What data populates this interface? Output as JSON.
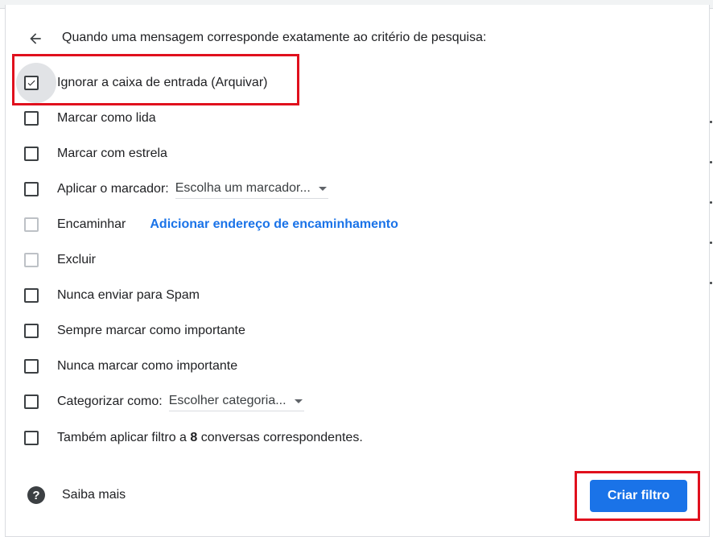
{
  "header": {
    "text": "Quando uma mensagem corresponde exatamente ao critério de pesquisa:"
  },
  "options": {
    "archive": "Ignorar a caixa de entrada (Arquivar)",
    "mark_read": "Marcar como lida",
    "star": "Marcar com estrela",
    "apply_label": "Aplicar o marcador:",
    "label_select": "Escolha um marcador...",
    "forward": "Encaminhar",
    "forward_link": "Adicionar endereço de encaminhamento",
    "delete": "Excluir",
    "never_spam": "Nunca enviar para Spam",
    "always_important": "Sempre marcar como importante",
    "never_important": "Nunca marcar como importante",
    "categorize": "Categorizar como:",
    "category_select": "Escolher categoria...",
    "also_apply_prefix": "Também aplicar filtro a",
    "also_apply_count": "8",
    "also_apply_suffix": "conversas correspondentes."
  },
  "footer": {
    "help_text": "Saiba mais",
    "create_button": "Criar filtro"
  },
  "colors": {
    "accent": "#1a73e8",
    "highlight": "#e0101d"
  },
  "checked": {
    "archive": true
  }
}
